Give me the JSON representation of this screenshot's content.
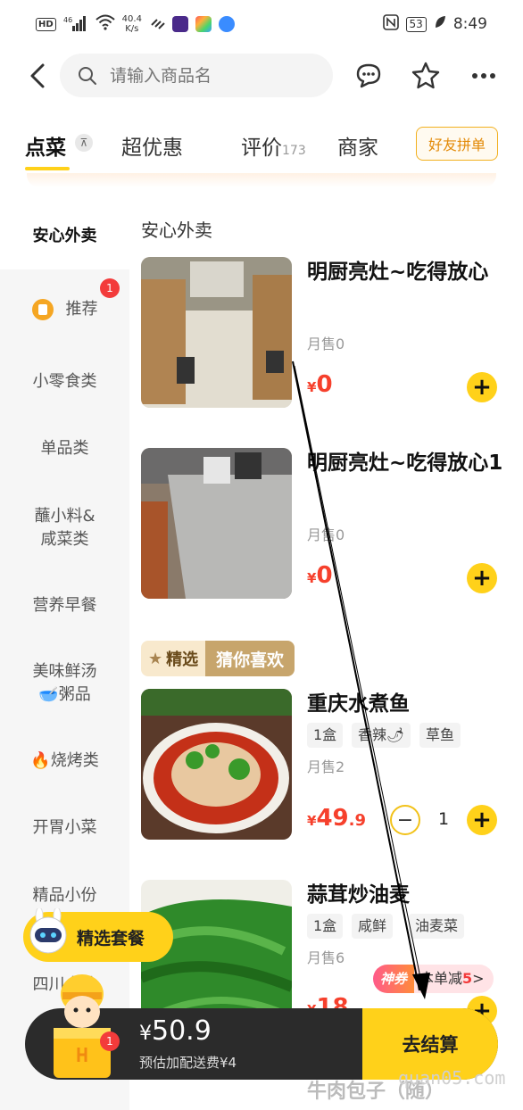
{
  "status_bar": {
    "hd": "HD",
    "signal": "⁴⁶",
    "speed_value": "40.4",
    "speed_unit": "K/s",
    "battery": "53",
    "time": "8:49"
  },
  "header": {
    "search_placeholder": "请输入商品名"
  },
  "tabs": {
    "order": "点菜",
    "deals": "超优惠",
    "reviews": "评价",
    "reviews_count": "173",
    "merchant": "商家",
    "group_button": "好友拼单"
  },
  "sidebar": {
    "items": [
      {
        "label": "安心外卖"
      },
      {
        "label": "推荐",
        "badge": "1"
      },
      {
        "label": "小零食类"
      },
      {
        "label": "单品类"
      },
      {
        "label": "蘸小料&"
      },
      {
        "label": "咸菜类"
      },
      {
        "label": "营养早餐"
      },
      {
        "label": "美味鲜汤"
      },
      {
        "label": "🥣粥品"
      },
      {
        "label": "🔥烧烤类"
      },
      {
        "label": "开胃小菜"
      },
      {
        "label": "精品小份"
      },
      {
        "label": "四川小炒"
      }
    ]
  },
  "section": {
    "title": "安心外卖"
  },
  "items": [
    {
      "name": "明厨亮灶~吃得放心",
      "sold": "月售0",
      "price_symbol": "¥",
      "price_int": "0",
      "price_frac": ""
    },
    {
      "name": "明厨亮灶~吃得放心1",
      "sold": "月售0",
      "price_symbol": "¥",
      "price_int": "0",
      "price_frac": ""
    },
    {
      "name": "重庆水煮鱼",
      "tags": [
        "1盒",
        "香辣🌶",
        "草鱼"
      ],
      "sold": "月售2",
      "price_symbol": "¥",
      "price_int": "49",
      "price_frac": ".9",
      "quantity": "1"
    },
    {
      "name": "蒜茸炒油麦",
      "tags": [
        "1盒",
        "咸鲜",
        "油麦菜"
      ],
      "sold": "月售6",
      "price_symbol": "¥",
      "price_int": "18",
      "price_frac": ""
    }
  ],
  "jingxuan": {
    "left": "精选",
    "right": "猜你喜欢"
  },
  "combo_button": "精选套餐",
  "promo": {
    "shen": "神券",
    "text": "本单减",
    "amount": "5",
    "arrow": ">"
  },
  "cart": {
    "badge": "1",
    "symbol": "¥",
    "amount": "50.9",
    "fee": "预估加配送费¥4",
    "checkout": "去结算"
  },
  "cut_text": "牛肉包子（随）",
  "watermark": "quan05.com",
  "colors": {
    "accent": "#ffd11a",
    "price": "#f6402c",
    "badge": "#f33b3b",
    "cart_bg": "#2b2b2b"
  }
}
